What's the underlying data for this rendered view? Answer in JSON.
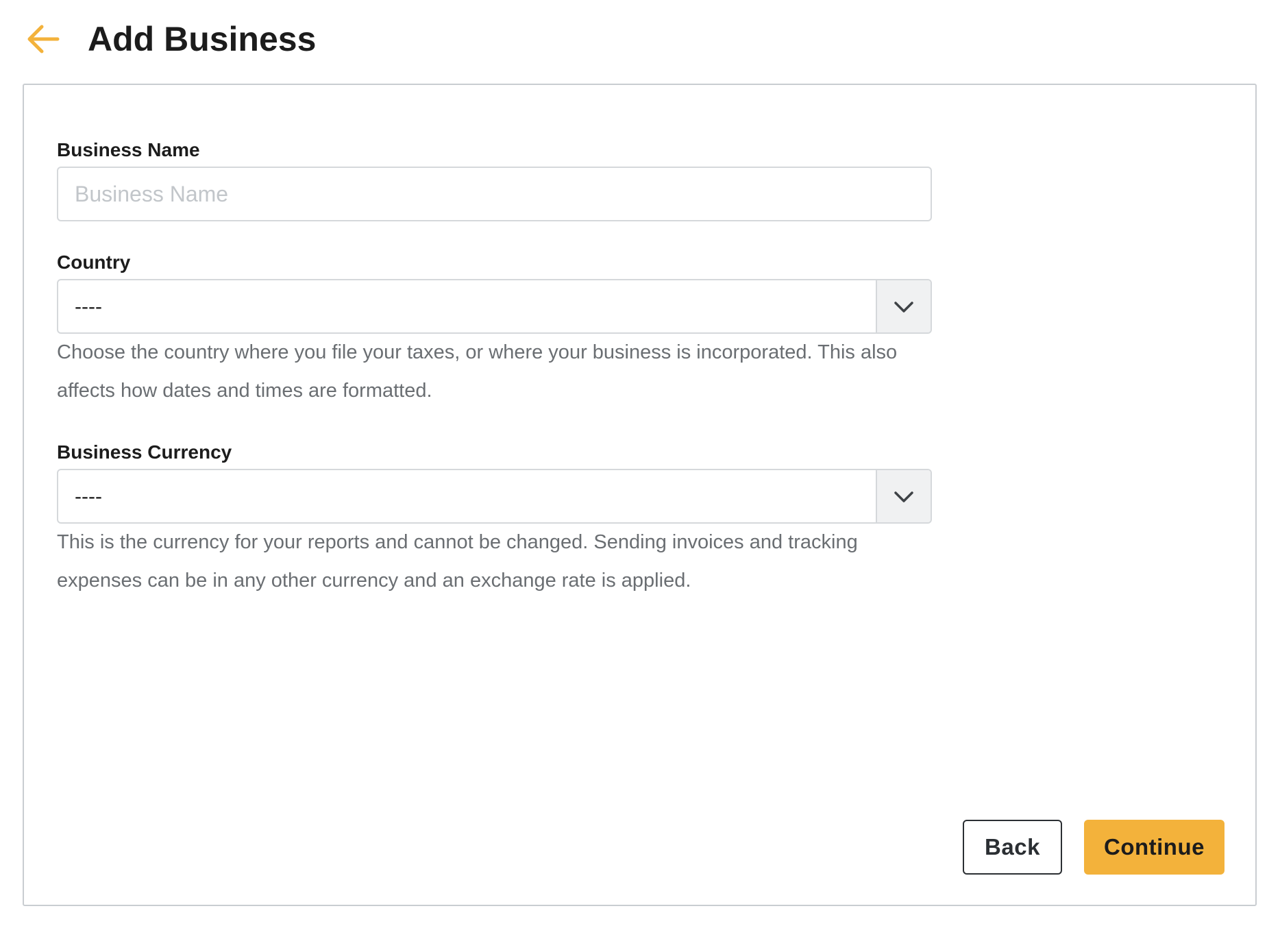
{
  "header": {
    "title": "Add Business",
    "back_icon": "arrow-left-icon",
    "accent_color": "#f3b23b"
  },
  "form": {
    "business_name": {
      "label": "Business Name",
      "placeholder": "Business Name",
      "value": ""
    },
    "country": {
      "label": "Country",
      "value": "----",
      "help": "Choose the country where you file your taxes, or where your business is incorporated. This also affects how dates and times are formatted."
    },
    "currency": {
      "label": "Business Currency",
      "value": "----",
      "help": "This is the currency for your reports and cannot be changed. Sending invoices and tracking expenses can be in any other currency and an exchange rate is applied."
    }
  },
  "actions": {
    "back_label": "Back",
    "continue_label": "Continue"
  }
}
